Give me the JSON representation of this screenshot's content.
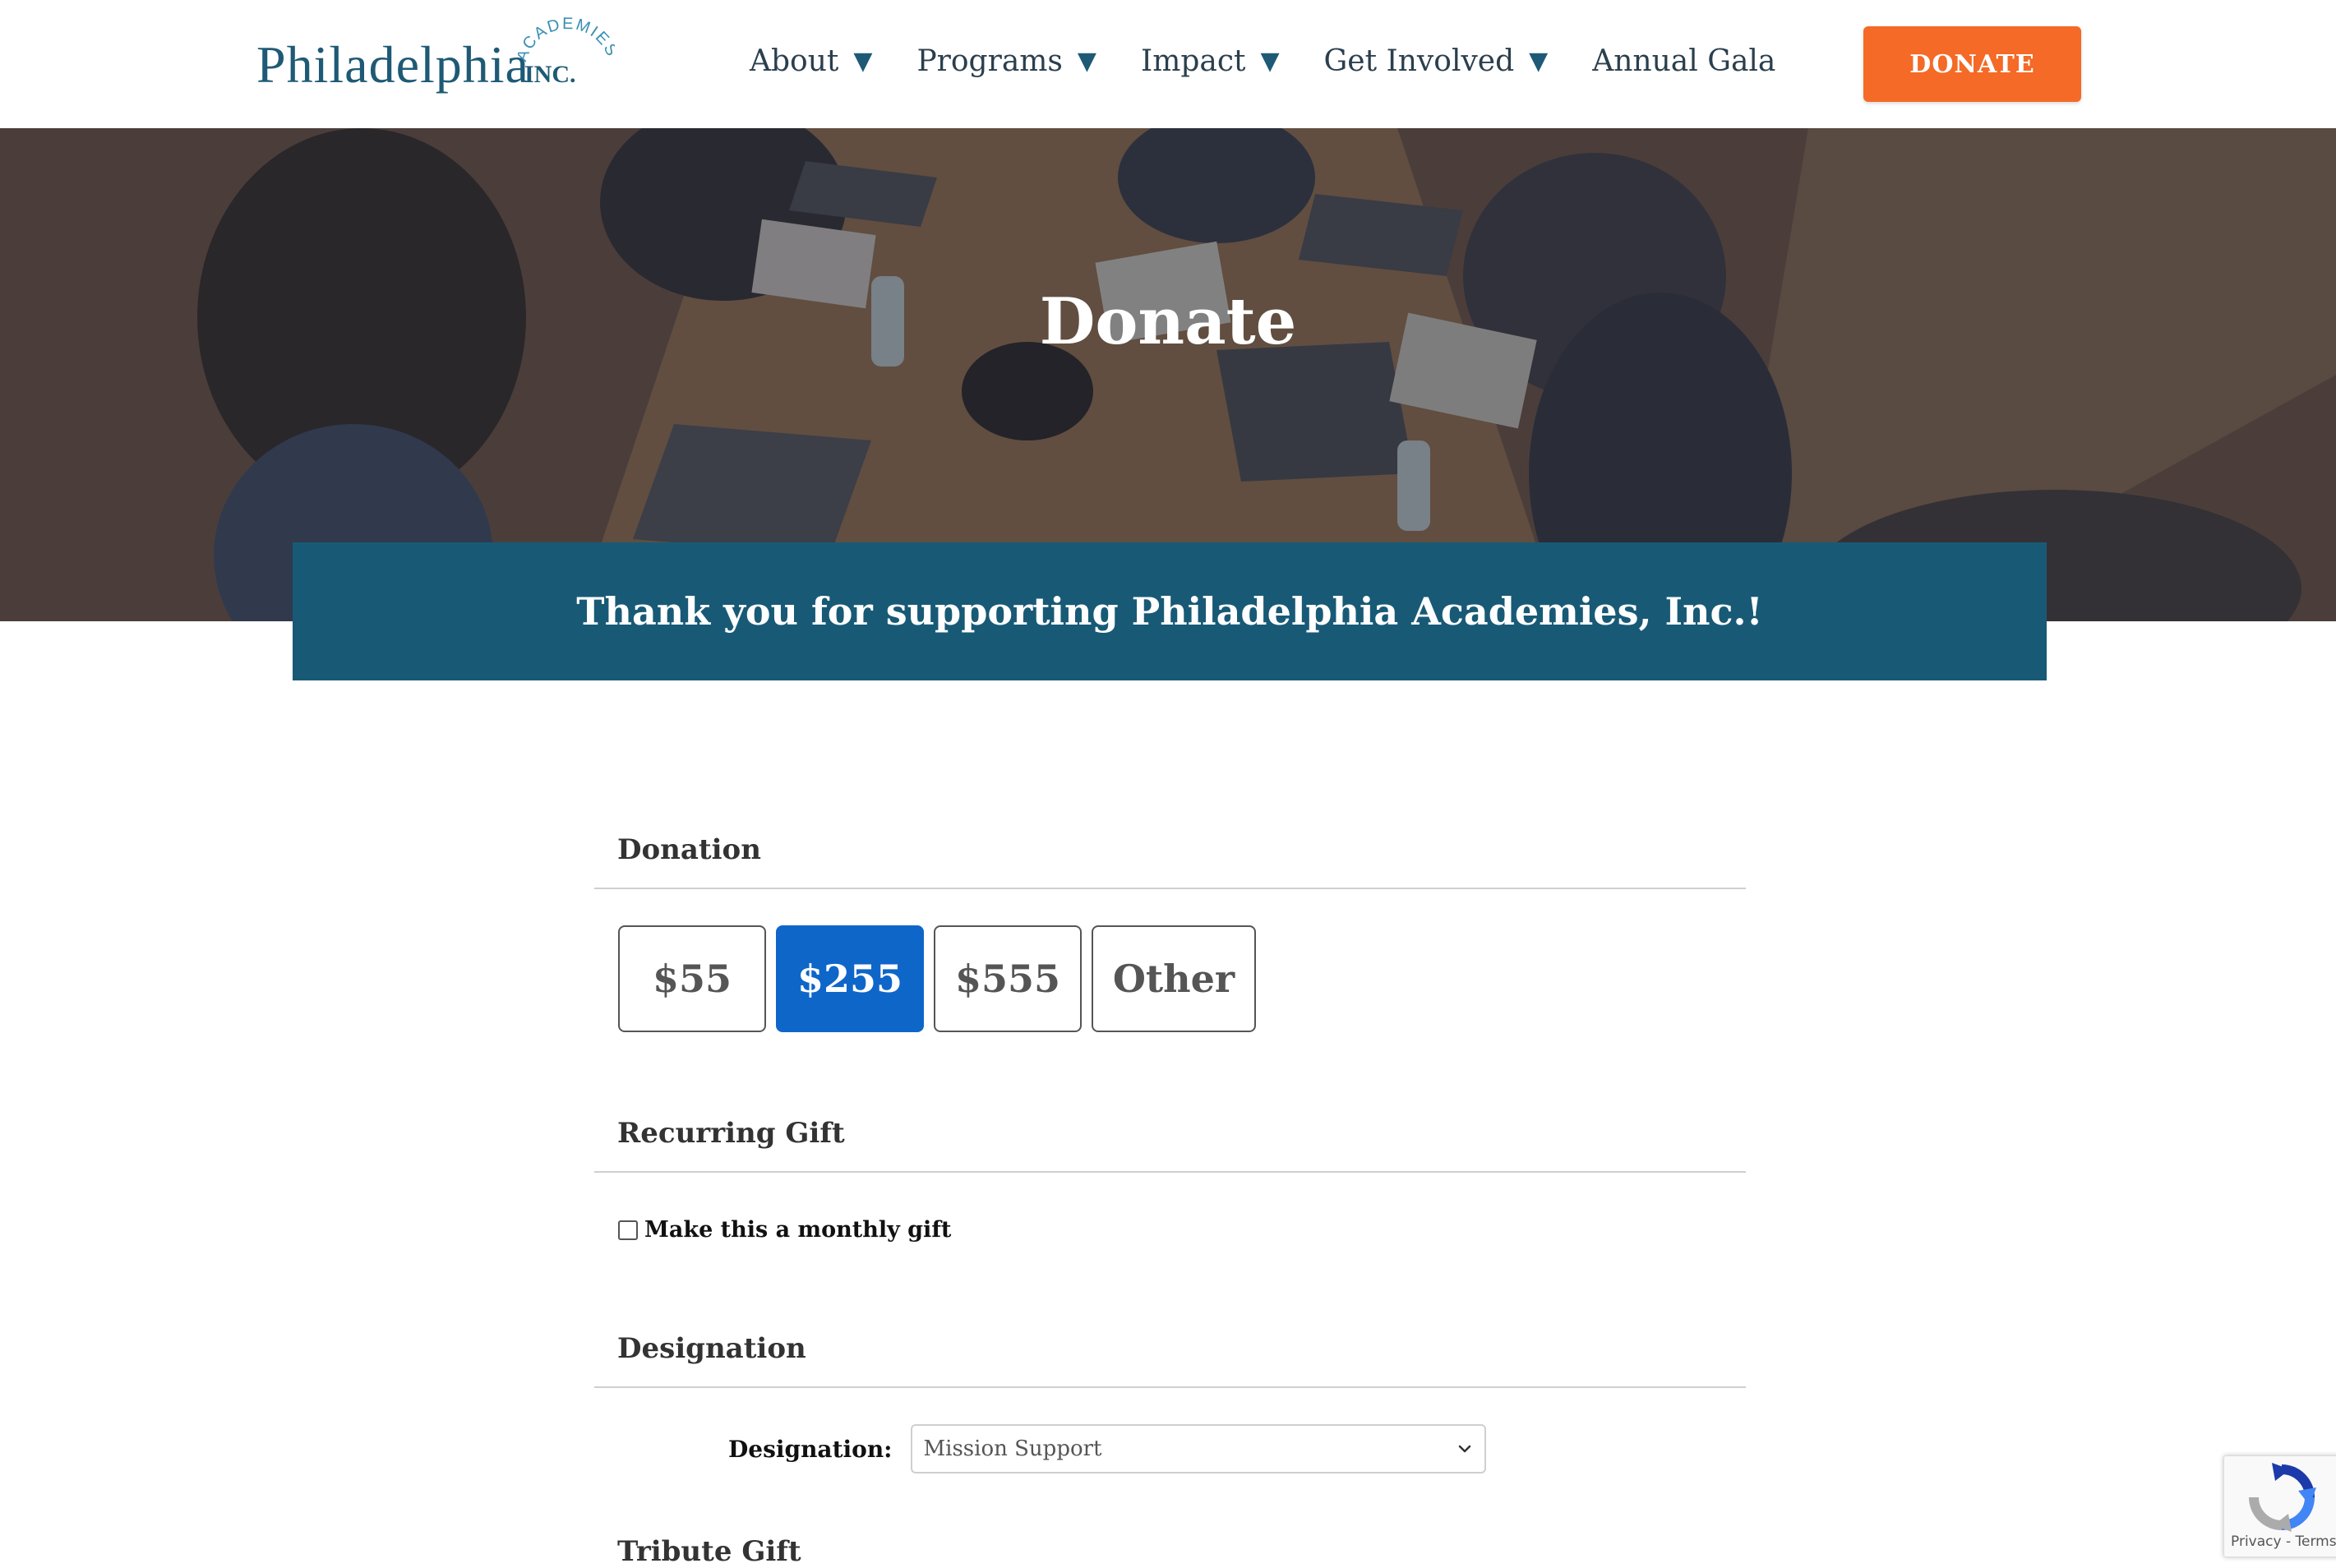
{
  "header": {
    "logo": {
      "name": "Philadelphia",
      "arc": "ACADEMIES",
      "suffix": "INC."
    },
    "nav": [
      {
        "label": "About",
        "dropdown": true
      },
      {
        "label": "Programs",
        "dropdown": true
      },
      {
        "label": "Impact",
        "dropdown": true
      },
      {
        "label": "Get Involved",
        "dropdown": true
      },
      {
        "label": "Annual Gala",
        "dropdown": false
      }
    ],
    "caret": "▼",
    "donate_button": "DONATE"
  },
  "hero": {
    "title": "Donate"
  },
  "banner": {
    "text": "Thank you for supporting Philadelphia Academies, Inc.!"
  },
  "form": {
    "donation": {
      "heading": "Donation",
      "amounts": [
        {
          "label": "$55",
          "selected": false
        },
        {
          "label": "$255",
          "selected": true
        },
        {
          "label": "$555",
          "selected": false
        },
        {
          "label": "Other",
          "selected": false
        }
      ]
    },
    "recurring": {
      "heading": "Recurring Gift",
      "checkbox_label": "Make this a monthly gift",
      "checked": false
    },
    "designation": {
      "heading": "Designation",
      "label": "Designation:",
      "selected_value": "Mission Support"
    },
    "tribute": {
      "heading": "Tribute Gift"
    }
  },
  "recaptcha": {
    "links": "Privacy - Terms"
  },
  "colors": {
    "brand_blue": "#1e5a76",
    "banner_blue": "#185a76",
    "donate_orange": "#f46a26",
    "selected_amount": "#0f66c9"
  }
}
